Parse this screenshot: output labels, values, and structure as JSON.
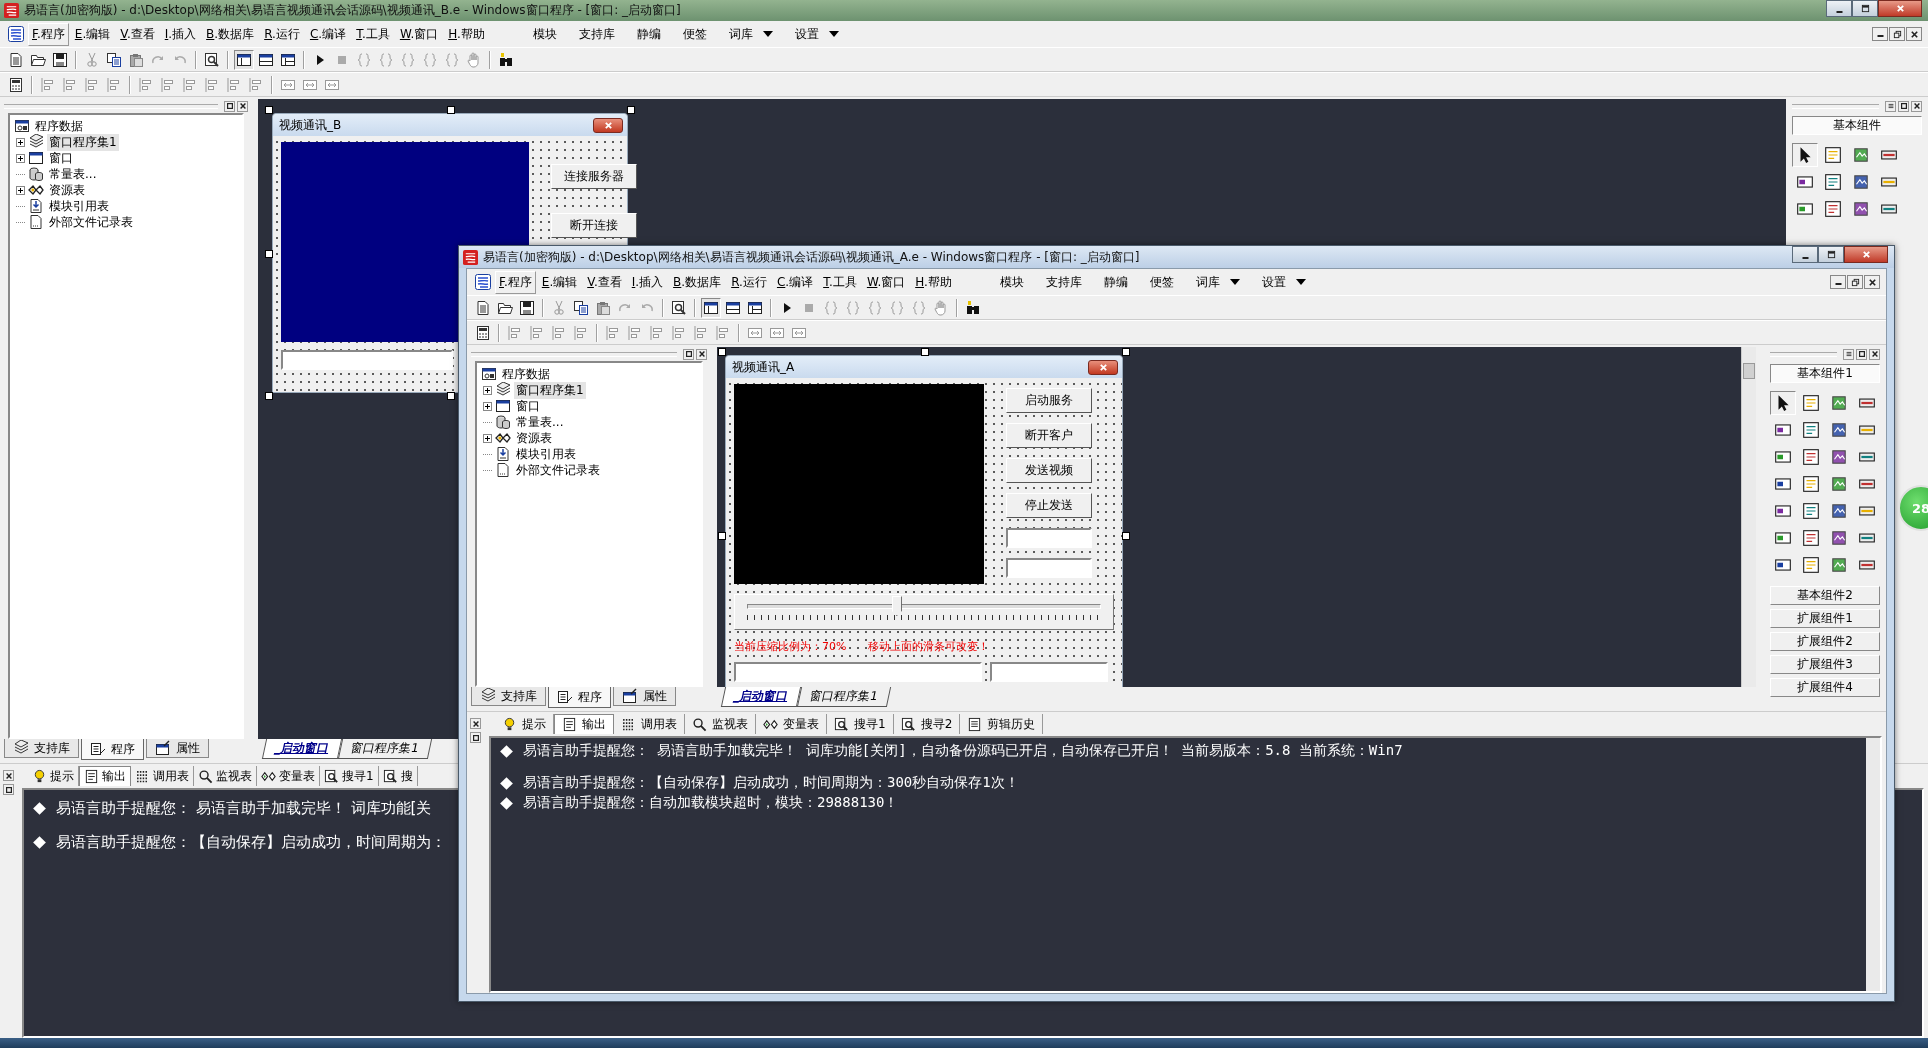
{
  "back_window": {
    "title": "易语言(加密狗版) - d:\\Desktop\\网络相关\\易语言视频通讯会话源码\\视频通讯_B.e - Windows窗口程序 - [窗口: _启动窗口]",
    "menu": [
      "F.程序",
      "E.编辑",
      "V.查看",
      "I.插入",
      "B.数据库",
      "R.运行",
      "C.编译",
      "T.工具",
      "W.窗口",
      "H.帮助"
    ],
    "menu_right": [
      {
        "label": "模块",
        "dropdown": false
      },
      {
        "label": "支持库",
        "dropdown": false
      },
      {
        "label": "静编",
        "dropdown": false
      },
      {
        "label": "便签",
        "dropdown": false
      },
      {
        "label": "词库",
        "dropdown": true
      },
      {
        "label": "设置",
        "dropdown": true
      }
    ],
    "tree": {
      "label": "程序数据",
      "children": [
        {
          "label": "窗口程序集1",
          "expandable": true,
          "selected": true
        },
        {
          "label": "窗口",
          "expandable": true,
          "selected": false
        },
        {
          "label": "常量表...",
          "expandable": false,
          "selected": false
        },
        {
          "label": "资源表",
          "expandable": true,
          "selected": false
        },
        {
          "label": "模块引用表",
          "expandable": false,
          "selected": false
        },
        {
          "label": "外部文件记录表",
          "expandable": false,
          "selected": false
        }
      ]
    },
    "panel_tabs": [
      {
        "label": "支持库",
        "selected": false
      },
      {
        "label": "程序",
        "selected": true
      },
      {
        "label": "属性",
        "selected": false
      }
    ],
    "form": {
      "title": "视频通讯_B",
      "buttons": [
        "连接服务器",
        "断开连接"
      ]
    },
    "designer_tabs": [
      {
        "label": "_启动窗口",
        "selected": true
      },
      {
        "label": "窗口程序集1",
        "selected": false
      }
    ],
    "output_tabs": [
      {
        "label": "提示",
        "selected": false
      },
      {
        "label": "输出",
        "selected": true
      },
      {
        "label": "调用表",
        "selected": false
      },
      {
        "label": "监视表",
        "selected": false
      },
      {
        "label": "变量表",
        "selected": false
      },
      {
        "label": "搜寻1",
        "selected": false
      },
      {
        "label": "搜",
        "selected": false
      }
    ],
    "output_lines": [
      "易语言助手提醒您：  易语言助手加载完毕！  词库功能[关",
      "易语言助手提醒您：【自动保存】启动成功，时间周期为："
    ],
    "toolbox": {
      "groups": [
        {
          "label": "基本组件",
          "expanded": true
        }
      ]
    }
  },
  "front_window": {
    "title": "易语言(加密狗版) - d:\\Desktop\\网络相关\\易语言视频通讯会话源码\\视频通讯_A.e - Windows窗口程序 - [窗口: _启动窗口]",
    "menu": [
      "F.程序",
      "E.编辑",
      "V.查看",
      "I.插入",
      "B.数据库",
      "R.运行",
      "C.编译",
      "T.工具",
      "W.窗口",
      "H.帮助"
    ],
    "menu_right": [
      {
        "label": "模块",
        "dropdown": false
      },
      {
        "label": "支持库",
        "dropdown": false
      },
      {
        "label": "静编",
        "dropdown": false
      },
      {
        "label": "便签",
        "dropdown": false
      },
      {
        "label": "词库",
        "dropdown": true
      },
      {
        "label": "设置",
        "dropdown": true
      }
    ],
    "tree": {
      "label": "程序数据",
      "children": [
        {
          "label": "窗口程序集1",
          "expandable": true,
          "selected": true
        },
        {
          "label": "窗口",
          "expandable": true,
          "selected": false
        },
        {
          "label": "常量表...",
          "expandable": false,
          "selected": false
        },
        {
          "label": "资源表",
          "expandable": true,
          "selected": false
        },
        {
          "label": "模块引用表",
          "expandable": false,
          "selected": false
        },
        {
          "label": "外部文件记录表",
          "expandable": false,
          "selected": false
        }
      ]
    },
    "panel_tabs": [
      {
        "label": "支持库",
        "selected": false
      },
      {
        "label": "程序",
        "selected": true
      },
      {
        "label": "属性",
        "selected": false
      }
    ],
    "form": {
      "title": "视频通讯_A",
      "buttons": [
        "启动服务",
        "断开客户",
        "发送视频",
        "停止发送"
      ],
      "slider": {
        "level": 0.42
      },
      "status": [
        "当前压缩比例为：70%",
        "移动上面的滑条可改变！"
      ]
    },
    "designer_tabs": [
      {
        "label": "_启动窗口",
        "selected": true
      },
      {
        "label": "窗口程序集1",
        "selected": false
      }
    ],
    "output_tabs": [
      {
        "label": "提示",
        "selected": false
      },
      {
        "label": "输出",
        "selected": true
      },
      {
        "label": "调用表",
        "selected": false
      },
      {
        "label": "监视表",
        "selected": false
      },
      {
        "label": "变量表",
        "selected": false
      },
      {
        "label": "搜寻1",
        "selected": false
      },
      {
        "label": "搜寻2",
        "selected": false
      },
      {
        "label": "剪辑历史",
        "selected": false
      }
    ],
    "output_lines": [
      "易语言助手提醒您：  易语言助手加载完毕！  词库功能[关闭]，自动备份源码已开启，自动保存已开启！  当前易版本：5.8  当前系统：Win7",
      "易语言助手提醒您：【自动保存】启动成功，时间周期为：300秒自动保存1次！",
      "易语言助手提醒您：自动加载模块超时，模块：29888130！"
    ],
    "toolbox": {
      "groups": [
        {
          "label": "基本组件1",
          "expanded": true
        },
        {
          "label": "基本组件2",
          "expanded": false
        },
        {
          "label": "扩展组件1",
          "expanded": false
        },
        {
          "label": "扩展组件2",
          "expanded": false
        },
        {
          "label": "扩展组件3",
          "expanded": false
        },
        {
          "label": "扩展组件4",
          "expanded": false
        }
      ]
    }
  },
  "floating_badge": "28"
}
